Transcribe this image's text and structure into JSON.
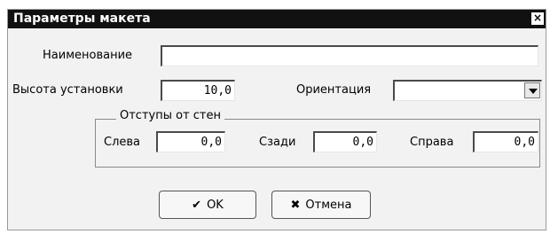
{
  "window": {
    "title": "Параметры макета",
    "close_glyph": "×"
  },
  "name": {
    "label": "Наименование",
    "value": ""
  },
  "height": {
    "label": "Высота установки",
    "value": "10,0"
  },
  "orientation": {
    "label": "Ориентация",
    "value": ""
  },
  "offsets": {
    "title": "Отступы от стен",
    "left": {
      "label": "Слева",
      "value": "0,0"
    },
    "back": {
      "label": "Сзади",
      "value": "0,0"
    },
    "right": {
      "label": "Справа",
      "value": "0,0"
    }
  },
  "buttons": {
    "ok_icon": "✔",
    "ok_label": "OK",
    "cancel_icon": "✖",
    "cancel_label": "Отмена"
  },
  "icons": {
    "close": "close-icon",
    "ok": "check-icon",
    "cancel": "cross-icon",
    "combo": "chevron-down-icon"
  }
}
